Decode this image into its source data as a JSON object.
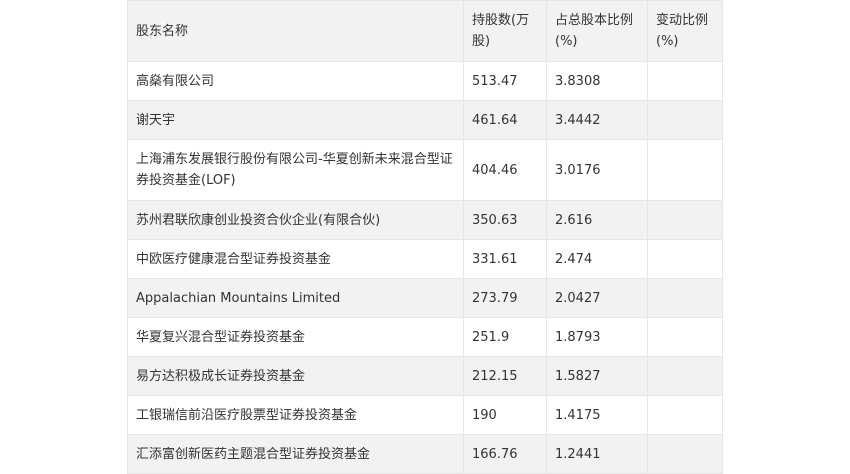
{
  "table": {
    "headers": [
      "股东名称",
      "持股数(万股)",
      "占总股本比例(%)",
      "变动比例(%)"
    ],
    "rows": [
      {
        "name": "高燊有限公司",
        "shares": "513.47",
        "ratio": "3.8308",
        "change": ""
      },
      {
        "name": "谢天宇",
        "shares": "461.64",
        "ratio": "3.4442",
        "change": ""
      },
      {
        "name": "上海浦东发展银行股份有限公司-华夏创新未来混合型证券投资基金(LOF)",
        "shares": "404.46",
        "ratio": "3.0176",
        "change": ""
      },
      {
        "name": "苏州君联欣康创业投资合伙企业(有限合伙)",
        "shares": "350.63",
        "ratio": "2.616",
        "change": ""
      },
      {
        "name": "中欧医疗健康混合型证券投资基金",
        "shares": "331.61",
        "ratio": "2.474",
        "change": ""
      },
      {
        "name": "Appalachian Mountains Limited",
        "shares": "273.79",
        "ratio": "2.0427",
        "change": ""
      },
      {
        "name": "华夏复兴混合型证券投资基金",
        "shares": "251.9",
        "ratio": "1.8793",
        "change": ""
      },
      {
        "name": "易方达积极成长证券投资基金",
        "shares": "212.15",
        "ratio": "1.5827",
        "change": ""
      },
      {
        "name": "工银瑞信前沿医疗股票型证券投资基金",
        "shares": "190",
        "ratio": "1.4175",
        "change": ""
      },
      {
        "name": "汇添富创新医药主题混合型证券投资基金",
        "shares": "166.76",
        "ratio": "1.2441",
        "change": ""
      }
    ]
  }
}
